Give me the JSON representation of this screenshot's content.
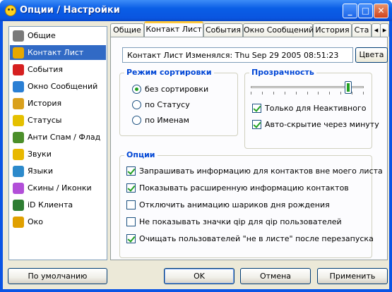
{
  "window": {
    "title": "Опции / Настройки",
    "controls": {
      "minimize": "_",
      "maximize": "□",
      "close": "✕"
    }
  },
  "sidebar": {
    "items": [
      {
        "label": "Общие",
        "icon": "gear-icon",
        "color": "#7a7a7a",
        "selected": false
      },
      {
        "label": "Контакт Лист",
        "icon": "contact-list-icon",
        "color": "#e8a800",
        "selected": true
      },
      {
        "label": "События",
        "icon": "events-icon",
        "color": "#d62020",
        "selected": false
      },
      {
        "label": "Окно Сообщений",
        "icon": "message-window-icon",
        "color": "#2a7fd4",
        "selected": false
      },
      {
        "label": "История",
        "icon": "history-icon",
        "color": "#d9a01c",
        "selected": false
      },
      {
        "label": "Статусы",
        "icon": "statuses-icon",
        "color": "#e5c000",
        "selected": false
      },
      {
        "label": "Анти Спам / Флад",
        "icon": "antispam-icon",
        "color": "#4c8f2a",
        "selected": false
      },
      {
        "label": "Звуки",
        "icon": "sounds-icon",
        "color": "#e8b800",
        "selected": false
      },
      {
        "label": "Языки",
        "icon": "languages-icon",
        "color": "#2c8acb",
        "selected": false
      },
      {
        "label": "Скины / Иконки",
        "icon": "skins-icon",
        "color": "#b24fd8",
        "selected": false
      },
      {
        "label": "iD Клиента",
        "icon": "client-id-icon",
        "color": "#2e7d32",
        "selected": false
      },
      {
        "label": "Око",
        "icon": "eye-icon",
        "color": "#e0a000",
        "selected": false
      }
    ]
  },
  "tabs": [
    {
      "label": "Общие",
      "active": false
    },
    {
      "label": "Контакт Лист",
      "active": true
    },
    {
      "label": "События",
      "active": false
    },
    {
      "label": "Окно Сообщений",
      "active": false
    },
    {
      "label": "История",
      "active": false
    },
    {
      "label": "Ста",
      "active": false
    }
  ],
  "tab_scroll": {
    "left": "◂",
    "right": "▸"
  },
  "contact_list": {
    "changed_text": "Контакт Лист Изменялся: Thu Sep 29 2005 08:51:23",
    "colors_button": "Цвета",
    "sort_mode": {
      "legend": "Режим сортировки",
      "options": [
        {
          "label": "без сортировки",
          "checked": true
        },
        {
          "label": "по Статусу",
          "checked": false
        },
        {
          "label": "по Именам",
          "checked": false
        }
      ]
    },
    "transparency": {
      "legend": "Прозрачность",
      "level_fraction": 0.86,
      "options": [
        {
          "label": "Только для Неактивного",
          "checked": true
        },
        {
          "label": "Авто-скрытие через минуту",
          "checked": true
        }
      ]
    },
    "options": {
      "legend": "Опции",
      "items": [
        {
          "label": "Запрашивать информацию для контактов вне моего листа",
          "checked": true
        },
        {
          "label": "Показывать расширенную информацию контактов",
          "checked": true
        },
        {
          "label": "Отключить анимацию шариков дня рождения",
          "checked": false
        },
        {
          "label": "Не показывать значки qip для qip пользователей",
          "checked": false
        },
        {
          "label": "Очищать пользователей \"не в листе\" после перезапуска",
          "checked": true
        }
      ]
    }
  },
  "buttons": {
    "defaults": "По умолчанию",
    "ok": "OK",
    "cancel": "Отмена",
    "apply": "Применить"
  }
}
